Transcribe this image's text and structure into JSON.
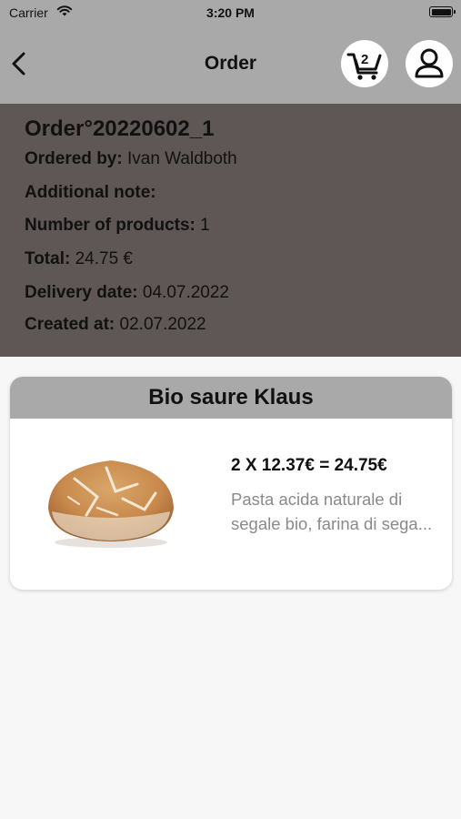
{
  "status_bar": {
    "carrier": "Carrier",
    "time": "3:20 PM",
    "icons": [
      "wifi-icon",
      "battery-icon"
    ]
  },
  "nav": {
    "title": "Order",
    "back_icon": "chevron-left-icon",
    "cart_icon": "shopping-cart-icon",
    "cart_count": "2",
    "profile_icon": "user-icon"
  },
  "order": {
    "title": "Order°20220602_1",
    "ordered_by_label": "Ordered by:",
    "ordered_by_value": "Ivan Waldboth",
    "note_label": "Additional note:",
    "note_value": "",
    "products_label": "Number of products:",
    "products_value": "1",
    "total_label": "Total:",
    "total_value": "24.75 €",
    "delivery_label": "Delivery date:",
    "delivery_value": "04.07.2022",
    "created_label": "Created at:",
    "created_value": "02.07.2022"
  },
  "products": [
    {
      "name": "Bio saure Klaus",
      "price_line": "2 X 12.37€ = 24.75€",
      "description": "Pasta acida naturale di segale bio, farina di sega..."
    }
  ],
  "colors": {
    "header_bg": "#a9a9a9",
    "summary_bg": "#5e5755",
    "page_bg": "#f7f7f7",
    "description_text": "#8a8a8a"
  }
}
